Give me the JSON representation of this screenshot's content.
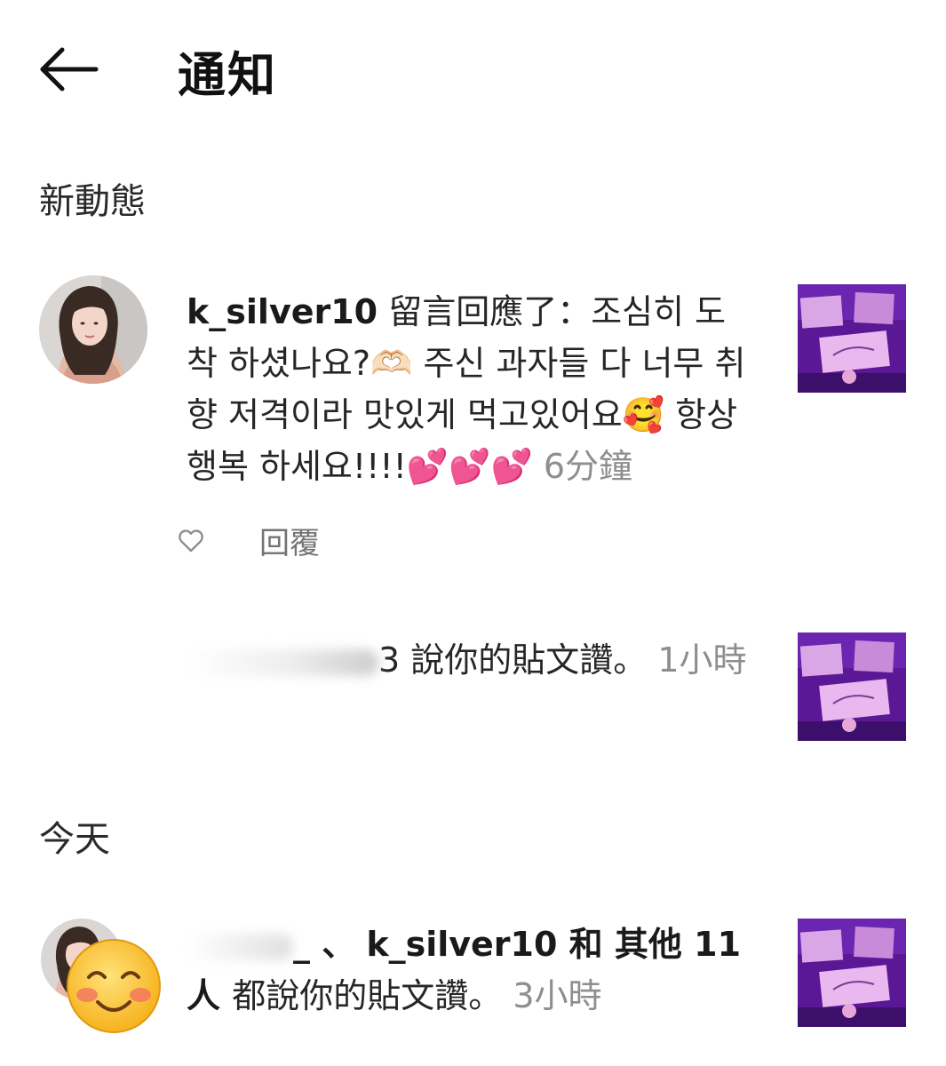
{
  "header": {
    "title": "通知",
    "back_icon": "arrow-left-icon"
  },
  "sections": {
    "new_label": "新動態",
    "today_label": "今天"
  },
  "notifications": [
    {
      "username": "k_silver10",
      "action": " 留言回應了：조심히 도착 하셨나요?🫶🏻 주신 과자들 다 너무 취향 저격이라 맛있게 먹고있어요🥰 항상 행복 하세요!!!!💕💕💕 ",
      "time": "6分鐘",
      "like_icon": "heart-outline-icon",
      "reply_label": "回覆"
    },
    {
      "partial_name": "3",
      "action": " 說你的貼文讚。 ",
      "time": "1小時"
    },
    {
      "partial_name": "_ 、",
      "username": "k_silver10",
      "action_1": " 和 其他 11 人 ",
      "action_2": "都說你的貼文讚。 ",
      "time": "3小時"
    }
  ],
  "colors": {
    "text": "#262626",
    "time": "#8e8e8e",
    "thumbnail_purple": "#6a1fa8"
  }
}
